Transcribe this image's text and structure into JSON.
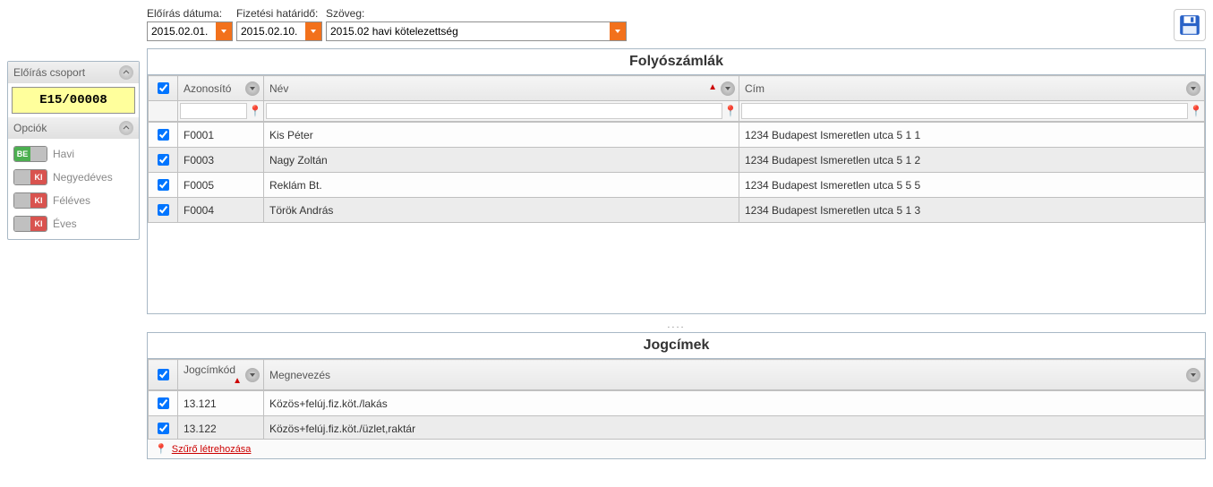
{
  "form": {
    "date_label": "Előírás dátuma:",
    "deadline_label": "Fizetési határidő:",
    "text_label": "Szöveg:",
    "date_value": "2015.02.01.",
    "deadline_value": "2015.02.10.",
    "text_value": "2015.02 havi kötelezettség"
  },
  "sidebar": {
    "group_header": "Előírás csoport",
    "group_id": "E15/00008",
    "options_header": "Opciók",
    "options": [
      {
        "state": "on",
        "on_text": "BE",
        "off_text": "",
        "label": "Havi"
      },
      {
        "state": "off",
        "on_text": "",
        "off_text": "KI",
        "label": "Negyedéves"
      },
      {
        "state": "off",
        "on_text": "",
        "off_text": "KI",
        "label": "Féléves"
      },
      {
        "state": "off",
        "on_text": "",
        "off_text": "KI",
        "label": "Éves"
      }
    ]
  },
  "accounts_grid": {
    "title": "Folyószámlák",
    "columns": {
      "id": "Azonosító",
      "name": "Név",
      "address": "Cím"
    },
    "rows": [
      {
        "id": "F0001",
        "name": "Kis Péter",
        "address": "1234 Budapest Ismeretlen utca 5 1 1"
      },
      {
        "id": "F0003",
        "name": "Nagy Zoltán",
        "address": "1234 Budapest Ismeretlen utca 5 1 2"
      },
      {
        "id": "F0005",
        "name": "Reklám Bt.",
        "address": "1234 Budapest Ismeretlen utca 5 5 5"
      },
      {
        "id": "F0004",
        "name": "Török András",
        "address": "1234 Budapest Ismeretlen utca 5 1 3"
      }
    ]
  },
  "titles_grid": {
    "title": "Jogcímek",
    "columns": {
      "code": "Jogcímkód",
      "name": "Megnevezés"
    },
    "rows": [
      {
        "code": "13.121",
        "name": "Közös+felúj.fiz.köt./lakás"
      },
      {
        "code": "13.122",
        "name": "Közös+felúj.fiz.köt./üzlet,raktár"
      }
    ],
    "footer_link": "Szűrő létrehozása"
  },
  "misc": {
    "splitter": "...."
  }
}
